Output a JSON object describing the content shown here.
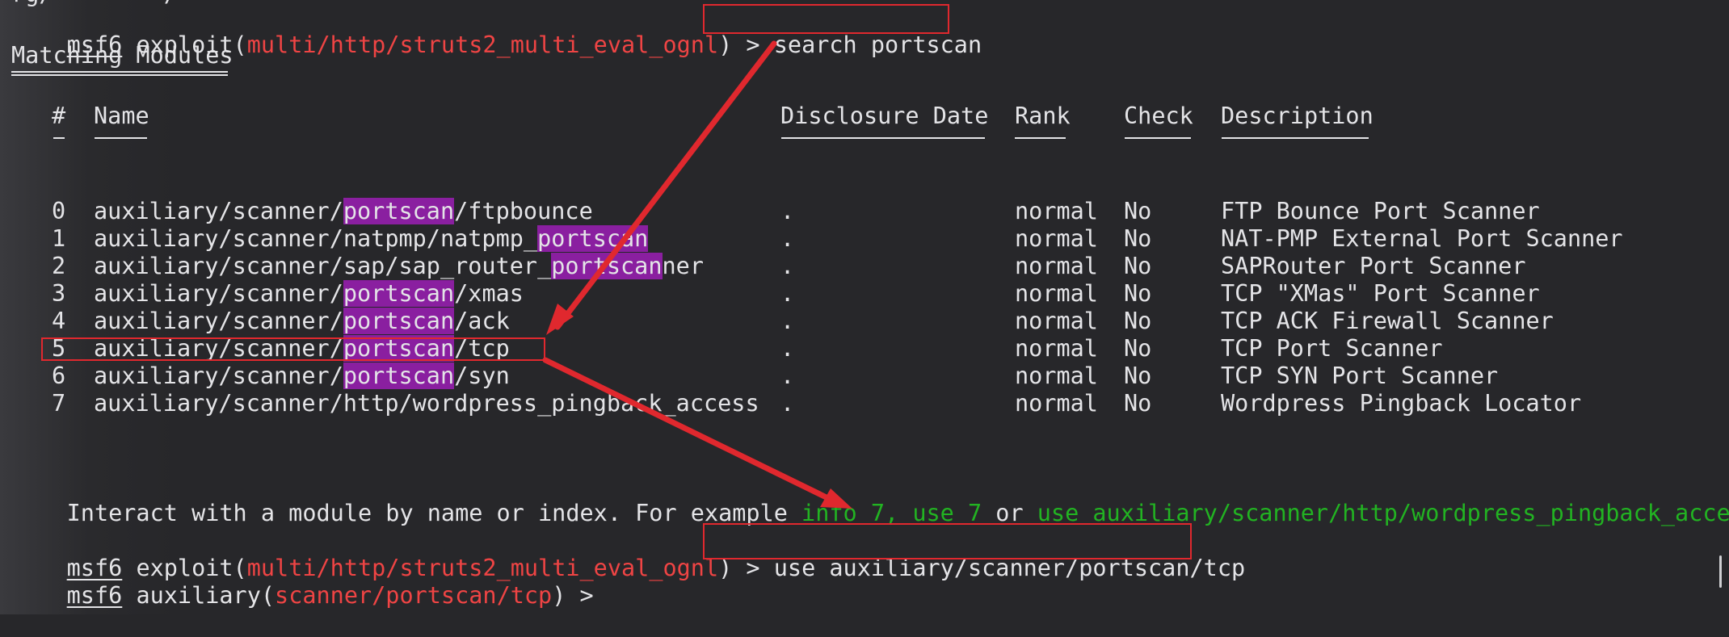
{
  "top_fragment": "rg/        /           ",
  "prompt1": {
    "user": "msf6",
    "ctx_pre": " exploit(",
    "module": "multi/http/struts2_multi_eval_ognl",
    "ctx_post": ") > ",
    "command": "search portscan"
  },
  "matching_heading": "Matching Modules",
  "table": {
    "headers": {
      "num": "#",
      "name": "Name",
      "date": "Disclosure Date",
      "rank": "Rank",
      "check": "Check",
      "desc": "Description"
    },
    "rows": [
      {
        "num": "0",
        "name_pre": "auxiliary/scanner/",
        "name_hl": "portscan",
        "name_post": "/ftpbounce",
        "date": ".",
        "rank": "normal",
        "check": "No",
        "desc": "FTP Bounce Port Scanner"
      },
      {
        "num": "1",
        "name_pre": "auxiliary/scanner/natpmp/natpmp_",
        "name_hl": "portscan",
        "name_post": "",
        "date": ".",
        "rank": "normal",
        "check": "No",
        "desc": "NAT-PMP External Port Scanner"
      },
      {
        "num": "2",
        "name_pre": "auxiliary/scanner/sap/sap_router_",
        "name_hl": "portscan",
        "name_post": "ner",
        "date": ".",
        "rank": "normal",
        "check": "No",
        "desc": "SAPRouter Port Scanner"
      },
      {
        "num": "3",
        "name_pre": "auxiliary/scanner/",
        "name_hl": "portscan",
        "name_post": "/xmas",
        "date": ".",
        "rank": "normal",
        "check": "No",
        "desc": "TCP \"XMas\" Port Scanner"
      },
      {
        "num": "4",
        "name_pre": "auxiliary/scanner/",
        "name_hl": "portscan",
        "name_post": "/ack",
        "date": ".",
        "rank": "normal",
        "check": "No",
        "desc": "TCP ACK Firewall Scanner"
      },
      {
        "num": "5",
        "name_pre": "auxiliary/scanner/",
        "name_hl": "portscan",
        "name_post": "/tcp",
        "date": ".",
        "rank": "normal",
        "check": "No",
        "desc": "TCP Port Scanner"
      },
      {
        "num": "6",
        "name_pre": "auxiliary/scanner/",
        "name_hl": "portscan",
        "name_post": "/syn",
        "date": ".",
        "rank": "normal",
        "check": "No",
        "desc": "TCP SYN Port Scanner"
      },
      {
        "num": "7",
        "name_pre": "auxiliary/scanner/http/wordpress_pingback_access",
        "name_hl": "",
        "name_post": "",
        "date": ".",
        "rank": "normal",
        "check": "No",
        "desc": "Wordpress Pingback Locator"
      }
    ]
  },
  "hint": {
    "text1": "Interact with a module by name or index. For example ",
    "cmd1": "info 7",
    "sep1": ", ",
    "cmd2": "use 7",
    "sep2": " or ",
    "cmd3": "use auxiliary/scanner/http/wordpress_pingback_access"
  },
  "prompt2": {
    "user": "msf6",
    "ctx_pre": " exploit(",
    "module": "multi/http/struts2_multi_eval_ognl",
    "ctx_post": ") > ",
    "command": "use auxiliary/scanner/portscan/tcp"
  },
  "prompt3": {
    "user": "msf6",
    "ctx_pre": " auxiliary(",
    "module": "scanner/portscan/tcp",
    "ctx_post": ") > "
  },
  "colors": {
    "background": "#27272a",
    "foreground": "#e4e4e7",
    "module_red": "#ef4444",
    "hint_green": "#22b322",
    "highlight_purple": "#8a1fa0",
    "annotation_red": "#e0282e"
  }
}
